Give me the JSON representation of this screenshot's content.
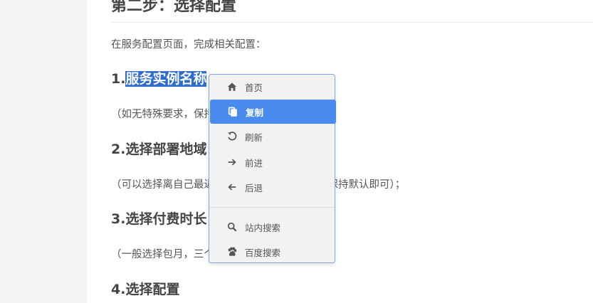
{
  "article": {
    "heading": "第二步：选择配置",
    "intro": "在服务配置页面，完成相关配置：",
    "steps": [
      {
        "num": "1.",
        "title": "服务实例名称",
        "note": "（如无特殊要求，保持默认即可）；"
      },
      {
        "num": "",
        "title": "2.选择部署地域",
        "note": "（可以选择离自己最近的地域，如无特殊要求，保持默认即可）；"
      },
      {
        "num": "",
        "title": "3.选择付费时长",
        "note": "（一般选择包月，三个月起优惠力度更大）；"
      },
      {
        "num": "",
        "title": "4.选择配置",
        "note": ""
      }
    ]
  },
  "context_menu": {
    "items": [
      {
        "label": "首页",
        "icon": "home-icon"
      },
      {
        "label": "复制",
        "icon": "copy-icon",
        "active": true
      },
      {
        "label": "刷新",
        "icon": "refresh-icon"
      },
      {
        "label": "前进",
        "icon": "arrow-right-icon"
      },
      {
        "label": "后退",
        "icon": "arrow-left-icon"
      },
      {
        "label": "站内搜索",
        "icon": "search-icon"
      },
      {
        "label": "百度搜索",
        "icon": "paw-icon"
      }
    ],
    "accent": "#4a8bf0"
  }
}
